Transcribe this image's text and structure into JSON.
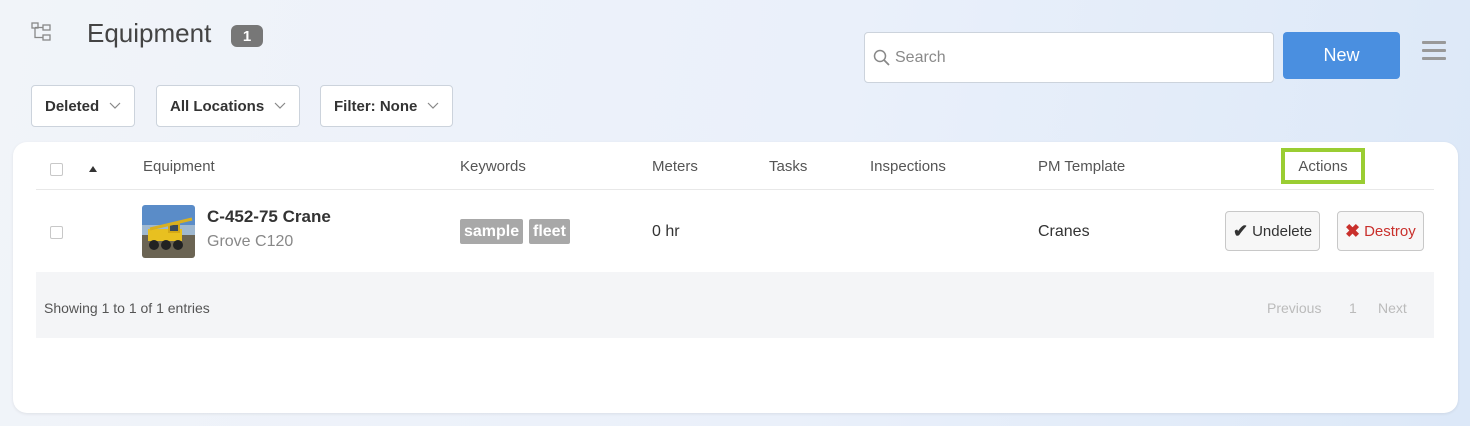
{
  "header": {
    "title": "Equipment",
    "count": "1",
    "search_placeholder": "Search",
    "new_label": "New",
    "icons": {
      "tree": "hierarchy-icon",
      "search": "search-icon",
      "menu": "hamburger-menu-icon"
    }
  },
  "filters": {
    "status": "Deleted",
    "location": "All Locations",
    "filter": "Filter: None"
  },
  "table": {
    "columns": [
      "Equipment",
      "Keywords",
      "Meters",
      "Tasks",
      "Inspections",
      "PM Template",
      "Actions"
    ],
    "rows": [
      {
        "name": "C-452-75 Crane",
        "model": "Grove C120",
        "keywords": [
          "sample",
          "fleet"
        ],
        "meters": "0 hr",
        "tasks": "",
        "inspections": "",
        "pm_template": "Cranes",
        "undelete_label": "Undelete",
        "destroy_label": "Destroy"
      }
    ]
  },
  "footer": {
    "showing": "Showing 1 to 1 of 1 entries",
    "previous": "Previous",
    "page": "1",
    "next": "Next"
  },
  "colors": {
    "primary": "#4a8fe0",
    "highlight": "#9acd32",
    "destroy": "#c9302c",
    "tag": "#a8a8a8"
  }
}
